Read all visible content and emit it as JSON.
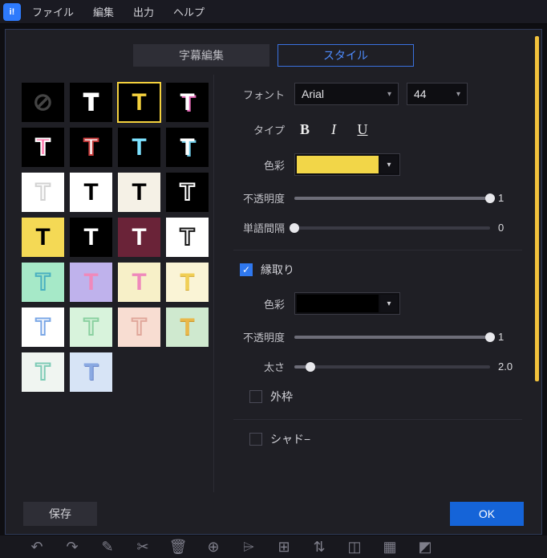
{
  "menubar": {
    "items": [
      "ファイル",
      "編集",
      "出力",
      "ヘルプ"
    ]
  },
  "tabs": {
    "inactive_label": "字幕編集",
    "active_label": "スタイル"
  },
  "style_presets": [
    {
      "name": "none",
      "bg": "#000000",
      "glyph": "⊘",
      "glyph_color": "#444444",
      "text_shadow": ""
    },
    {
      "name": "white-outline",
      "bg": "#000000",
      "glyph": "T",
      "glyph_color": "transparent",
      "text_shadow": "0 0 0 #ffffff",
      "stroke": "#ffffff"
    },
    {
      "name": "yellow-black",
      "bg": "#000000",
      "glyph": "T",
      "glyph_color": "#f4d13d",
      "text_shadow": "",
      "selected": true
    },
    {
      "name": "white-pink-shadow",
      "bg": "#000000",
      "glyph": "T",
      "glyph_color": "#ffffff",
      "text_shadow": "2px 2px 0 #e46ab8"
    },
    {
      "name": "pink-white-outline",
      "bg": "#000000",
      "glyph": "T",
      "glyph_color": "#ff6fa8",
      "text_shadow": "",
      "stroke": "#ffffff"
    },
    {
      "name": "white-red-outline",
      "bg": "#000000",
      "glyph": "T",
      "glyph_color": "#ffffff",
      "text_shadow": "",
      "stroke": "#c83c3c"
    },
    {
      "name": "cyan",
      "bg": "#000000",
      "glyph": "T",
      "glyph_color": "#7de2ff",
      "text_shadow": ""
    },
    {
      "name": "white-cyan-shadow",
      "bg": "#000000",
      "glyph": "T",
      "glyph_color": "#ffffff",
      "text_shadow": "2px 2px 0 #6cc9e6"
    },
    {
      "name": "outline-white-bg",
      "bg": "#ffffff",
      "glyph": "T",
      "glyph_color": "transparent",
      "text_shadow": "",
      "stroke": "#d2d2d2"
    },
    {
      "name": "black-on-white",
      "bg": "#ffffff",
      "glyph": "T",
      "glyph_color": "#000000",
      "text_shadow": ""
    },
    {
      "name": "black-on-ivory",
      "bg": "#f5f1e6",
      "glyph": "T",
      "glyph_color": "#000000",
      "text_shadow": ""
    },
    {
      "name": "outline-black-bg",
      "bg": "#000000",
      "glyph": "T",
      "glyph_color": "transparent",
      "text_shadow": "",
      "stroke": "#ffffff"
    },
    {
      "name": "black-on-yellow",
      "bg": "#f4d955",
      "glyph": "T",
      "glyph_color": "#000000",
      "text_shadow": ""
    },
    {
      "name": "white-on-black",
      "bg": "#000000",
      "glyph": "T",
      "glyph_color": "#ffffff",
      "text_shadow": ""
    },
    {
      "name": "white-on-maroon",
      "bg": "#6a2338",
      "glyph": "T",
      "glyph_color": "#ffffff",
      "text_shadow": ""
    },
    {
      "name": "outline-white-bg-2",
      "bg": "#ffffff",
      "glyph": "T",
      "glyph_color": "transparent",
      "text_shadow": "",
      "stroke": "#141414"
    },
    {
      "name": "cyan-outline-mint",
      "bg": "#a6e9c8",
      "glyph": "T",
      "glyph_color": "transparent",
      "text_shadow": "",
      "stroke": "#49b0c0"
    },
    {
      "name": "pink-violet",
      "bg": "#bfb2ec",
      "glyph": "T",
      "glyph_color": "#ef89bb",
      "text_shadow": ""
    },
    {
      "name": "pink-cream",
      "bg": "#f7f0c8",
      "glyph": "T",
      "glyph_color": "#ef89bb",
      "text_shadow": ""
    },
    {
      "name": "yellow-cream",
      "bg": "#faf4d6",
      "glyph": "T",
      "glyph_color": "#f1cf55",
      "text_shadow": "0 1px 0 #d2a838"
    },
    {
      "name": "blue-outline-white",
      "bg": "#ffffff",
      "glyph": "T",
      "glyph_color": "transparent",
      "text_shadow": "",
      "stroke": "#7aa7e6"
    },
    {
      "name": "mint-outline-pale",
      "bg": "#d8f3dc",
      "glyph": "T",
      "glyph_color": "transparent",
      "text_shadow": "",
      "stroke": "#8ad0a0"
    },
    {
      "name": "peach-outline-pink",
      "bg": "#f8ddd2",
      "glyph": "T",
      "glyph_color": "transparent",
      "text_shadow": "",
      "stroke": "#e0a79b"
    },
    {
      "name": "gold-on-mint",
      "bg": "#cfe9cf",
      "glyph": "T",
      "glyph_color": "#e9b84a",
      "text_shadow": "0 1px 0 #c98f1f"
    },
    {
      "name": "teal-outline-white",
      "bg": "#f0f5f1",
      "glyph": "T",
      "glyph_color": "transparent",
      "text_shadow": "",
      "stroke": "#7ecbb6"
    },
    {
      "name": "blue-soft",
      "bg": "#d7e4f6",
      "glyph": "T",
      "glyph_color": "#8aa9e2",
      "text_shadow": "1px 1px 0 #6b86c8"
    }
  ],
  "settings": {
    "font_label": "フォント",
    "font_value": "Arial",
    "size_value": "44",
    "type_label": "タイプ",
    "color_label": "色彩",
    "color_value": "#f2d648",
    "opacity_label": "不透明度",
    "opacity_value": "1",
    "opacity_pct": 100,
    "wordspacing_label": "単語間隔",
    "wordspacing_value": "0",
    "wordspacing_pct": 0,
    "outline_checked_label": "縁取り",
    "outline_color_label": "色彩",
    "outline_color_value": "#000000",
    "outline_opacity_label": "不透明度",
    "outline_opacity_value": "1",
    "outline_opacity_pct": 100,
    "outline_thick_label": "太さ",
    "outline_thick_value": "2.0",
    "outline_thick_pct": 8,
    "outer_frame_label": "外枠",
    "shadow_label": "シャド−"
  },
  "footer": {
    "save_label": "保存",
    "ok_label": "OK"
  },
  "toolbar_icons": [
    "undo-icon",
    "redo-icon",
    "pencil-icon",
    "cut-icon",
    "trash-icon",
    "add-icon",
    "caption-icon",
    "marker-icon",
    "adjust-icon",
    "crop-icon",
    "grid-icon",
    "layers-icon"
  ],
  "toolbar_glyphs": {
    "undo-icon": "↶",
    "redo-icon": "↷",
    "pencil-icon": "✎",
    "cut-icon": "✂",
    "trash-icon": "🗑",
    "add-icon": "⊕",
    "caption-icon": "⌲",
    "marker-icon": "⊞",
    "adjust-icon": "⇅",
    "crop-icon": "◫",
    "grid-icon": "▦",
    "layers-icon": "◩"
  }
}
